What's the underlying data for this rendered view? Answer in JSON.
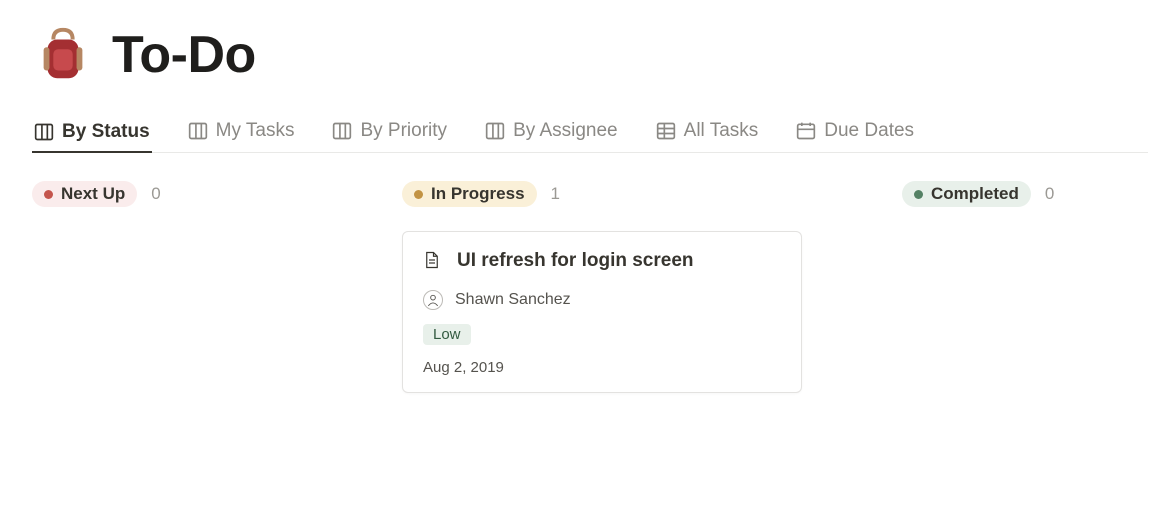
{
  "page": {
    "title": "To-Do",
    "icon_name": "backpack"
  },
  "views": [
    {
      "label": "By Status",
      "icon": "board",
      "active": true
    },
    {
      "label": "My Tasks",
      "icon": "board",
      "active": false
    },
    {
      "label": "By Priority",
      "icon": "board",
      "active": false
    },
    {
      "label": "By Assignee",
      "icon": "board",
      "active": false
    },
    {
      "label": "All Tasks",
      "icon": "table",
      "active": false
    },
    {
      "label": "Due Dates",
      "icon": "calendar",
      "active": false
    }
  ],
  "board": {
    "columns": [
      {
        "name": "Next Up",
        "color": "red",
        "count": 0,
        "cards": []
      },
      {
        "name": "In Progress",
        "color": "yellow",
        "count": 1,
        "cards": [
          {
            "title": "UI refresh for login screen",
            "assignee": {
              "name": "Shawn Sanchez"
            },
            "priority": "Low",
            "due": "Aug 2, 2019"
          }
        ]
      },
      {
        "name": "Completed",
        "color": "green",
        "count": 0,
        "cards": []
      }
    ]
  }
}
